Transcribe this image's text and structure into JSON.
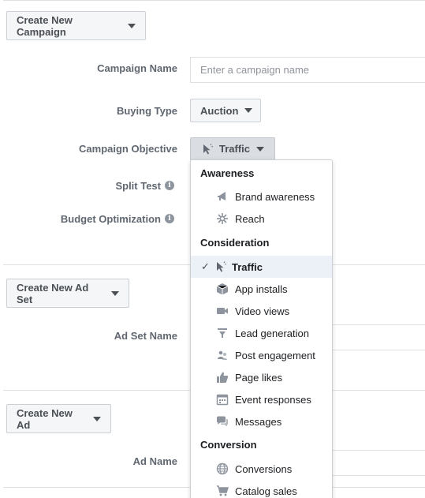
{
  "campaign": {
    "create_button": "Create New Campaign",
    "name_label": "Campaign Name",
    "name_placeholder": "Enter a campaign name",
    "buying_type_label": "Buying Type",
    "buying_type_value": "Auction",
    "objective_label": "Campaign Objective",
    "objective_value": "Traffic",
    "split_test_label": "Split Test",
    "budget_label": "Budget Optimization"
  },
  "adset": {
    "create_button": "Create New Ad Set",
    "name_label": "Ad Set Name"
  },
  "ad": {
    "create_button": "Create New Ad",
    "name_label": "Ad Name"
  },
  "info_glyph": "i",
  "check_glyph": "✓",
  "objective_menu": {
    "groups": [
      {
        "heading": "Awareness",
        "items": [
          {
            "label": "Brand awareness",
            "icon": "megaphone-icon"
          },
          {
            "label": "Reach",
            "icon": "reach-icon"
          }
        ]
      },
      {
        "heading": "Consideration",
        "items": [
          {
            "label": "Traffic",
            "icon": "cursor-icon",
            "selected": true
          },
          {
            "label": "App installs",
            "icon": "box-icon"
          },
          {
            "label": "Video views",
            "icon": "video-camera-icon"
          },
          {
            "label": "Lead generation",
            "icon": "funnel-icon"
          },
          {
            "label": "Post engagement",
            "icon": "people-icon"
          },
          {
            "label": "Page likes",
            "icon": "thumbs-up-icon"
          },
          {
            "label": "Event responses",
            "icon": "calendar-icon"
          },
          {
            "label": "Messages",
            "icon": "chat-bubbles-icon"
          }
        ]
      },
      {
        "heading": "Conversion",
        "items": [
          {
            "label": "Conversions",
            "icon": "globe-icon"
          },
          {
            "label": "Catalog sales",
            "icon": "cart-icon"
          }
        ]
      }
    ]
  },
  "colors": {
    "label": "#606770",
    "button_bg": "#f5f6f7",
    "selected_bg": "#ecf0f7",
    "icon_gray": "#8d949e"
  }
}
